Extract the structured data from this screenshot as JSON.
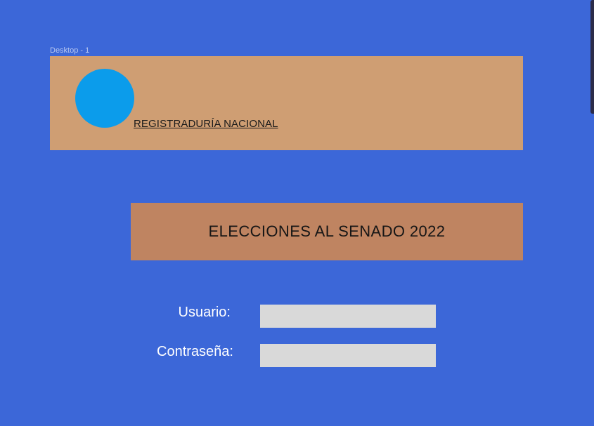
{
  "canvas": {
    "frame_label": "Desktop - 1"
  },
  "header": {
    "org_name": "REGISTRADURÍA NACIONAL",
    "logo_icon": "circle-logo-icon"
  },
  "banner": {
    "title": "ELECCIONES AL SENADO 2022"
  },
  "login": {
    "user_label": "Usuario:",
    "user_value": "",
    "password_label": "Contraseña:",
    "password_value": ""
  },
  "colors": {
    "background": "#3c67d8",
    "header_bg": "#cf9e73",
    "banner_bg": "#bf8461",
    "logo": "#0b9ceb",
    "input_bg": "#d9d9d9"
  }
}
